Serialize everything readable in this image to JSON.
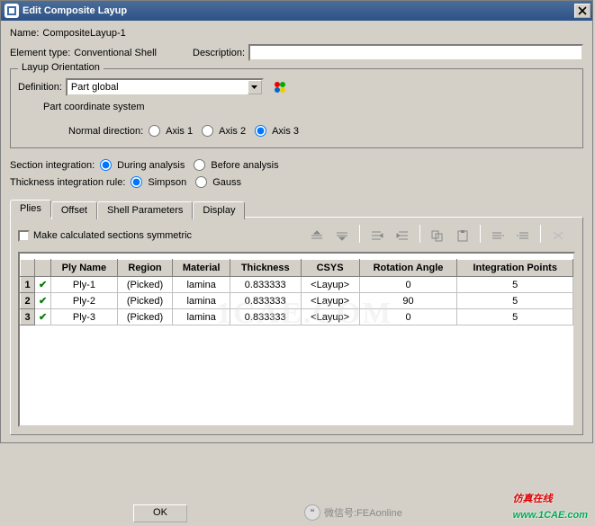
{
  "titlebar": {
    "title": "Edit Composite Layup"
  },
  "header": {
    "name_label": "Name:",
    "name_value": "CompositeLayup-1",
    "element_type_label": "Element type:",
    "element_type_value": "Conventional Shell",
    "description_label": "Description:",
    "description_value": ""
  },
  "orientation": {
    "group_title": "Layup Orientation",
    "definition_label": "Definition:",
    "definition_value": "Part global",
    "subtext": "Part coordinate system",
    "normal_label": "Normal direction:",
    "axis1": "Axis 1",
    "axis2": "Axis 2",
    "axis3": "Axis 3",
    "selected_axis": 3
  },
  "integration": {
    "section_label": "Section integration:",
    "during": "During analysis",
    "before": "Before analysis",
    "thickness_label": "Thickness integration rule:",
    "simpson": "Simpson",
    "gauss": "Gauss"
  },
  "tabs": {
    "plies": "Plies",
    "offset": "Offset",
    "shell": "Shell Parameters",
    "display": "Display",
    "active": "plies"
  },
  "plies_tab": {
    "symmetric_label": "Make calculated sections symmetric",
    "symmetric_checked": false,
    "columns": {
      "idx": "",
      "chk": "",
      "name": "Ply Name",
      "region": "Region",
      "material": "Material",
      "thickness": "Thickness",
      "csys": "CSYS",
      "angle": "Rotation Angle",
      "points": "Integration Points"
    },
    "rows": [
      {
        "n": "1",
        "name": "Ply-1",
        "region": "(Picked)",
        "material": "lamina",
        "thickness": "0.833333",
        "csys": "<Layup>",
        "angle": "0",
        "points": "5"
      },
      {
        "n": "2",
        "name": "Ply-2",
        "region": "(Picked)",
        "material": "lamina",
        "thickness": "0.833333",
        "csys": "<Layup>",
        "angle": "90",
        "points": "5"
      },
      {
        "n": "3",
        "name": "Ply-3",
        "region": "(Picked)",
        "material": "lamina",
        "thickness": "0.833333",
        "csys": "<Layup>",
        "angle": "0",
        "points": "5"
      }
    ]
  },
  "buttons": {
    "ok": "OK"
  },
  "watermarks": {
    "big": "1CAE.COM",
    "wechat": "微信号:FEAonline",
    "brand": "仿真在线",
    "url": "www.1CAE.com"
  }
}
